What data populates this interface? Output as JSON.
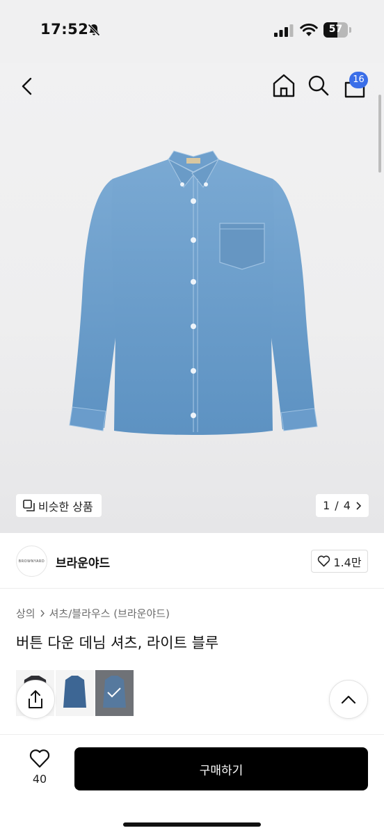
{
  "status_bar": {
    "time": "17:52",
    "battery_level": "57",
    "icons": [
      "bell-off-icon",
      "signal-icon",
      "wifi-icon",
      "battery-icon"
    ]
  },
  "nav": {
    "icons": [
      "back-icon",
      "home-icon",
      "search-icon",
      "cart-icon"
    ],
    "cart_badge": "16"
  },
  "hero": {
    "similar_label": "비슷한 상품",
    "pager_current": "1",
    "pager_sep": "/",
    "pager_total": "4",
    "shirt_color": "#6a9bc7"
  },
  "brand": {
    "logo_text": "BROWNYARD",
    "name": "브라운야드",
    "likes": "1.4만"
  },
  "product": {
    "breadcrumb": [
      "상의",
      "셔츠/블라우스 (브라운야드)"
    ],
    "title": "버튼 다운 데님 셔츠, 라이트 블루",
    "swatch_colors": [
      "#2f2f34",
      "#3d6694",
      "#56799e"
    ]
  },
  "bottom": {
    "wish_count": "40",
    "buy_label": "구매하기"
  },
  "colors": {
    "badge": "#3a6ee8",
    "buy_button": "#000000"
  }
}
